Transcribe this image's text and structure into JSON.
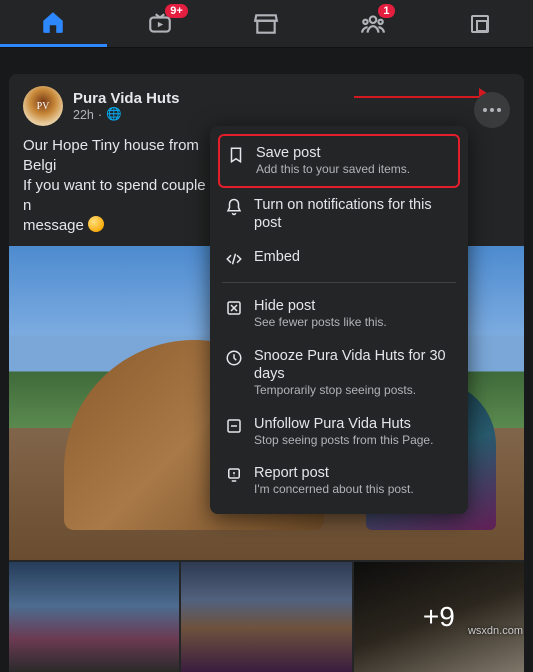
{
  "nav": {
    "watch_badge": "9+",
    "groups_badge": "1"
  },
  "post": {
    "author": "Pura Vida Huts",
    "time": "22h",
    "privacy_glyph": "🌐",
    "text_line1": "Our Hope Tiny house from Belgi",
    "text_line2": "If you want to spend couple of n",
    "text_line3": "message",
    "overlay_count": "+9"
  },
  "menu": {
    "save": {
      "title": "Save post",
      "sub": "Add this to your saved items."
    },
    "notify": {
      "title": "Turn on notifications for this post"
    },
    "embed": {
      "title": "Embed"
    },
    "hide": {
      "title": "Hide post",
      "sub": "See fewer posts like this."
    },
    "snooze": {
      "title": "Snooze Pura Vida Huts for 30 days",
      "sub": "Temporarily stop seeing posts."
    },
    "unfollow": {
      "title": "Unfollow Pura Vida Huts",
      "sub": "Stop seeing posts from this Page."
    },
    "report": {
      "title": "Report post",
      "sub": "I'm concerned about this post."
    }
  },
  "credit": "wsxdn.com"
}
